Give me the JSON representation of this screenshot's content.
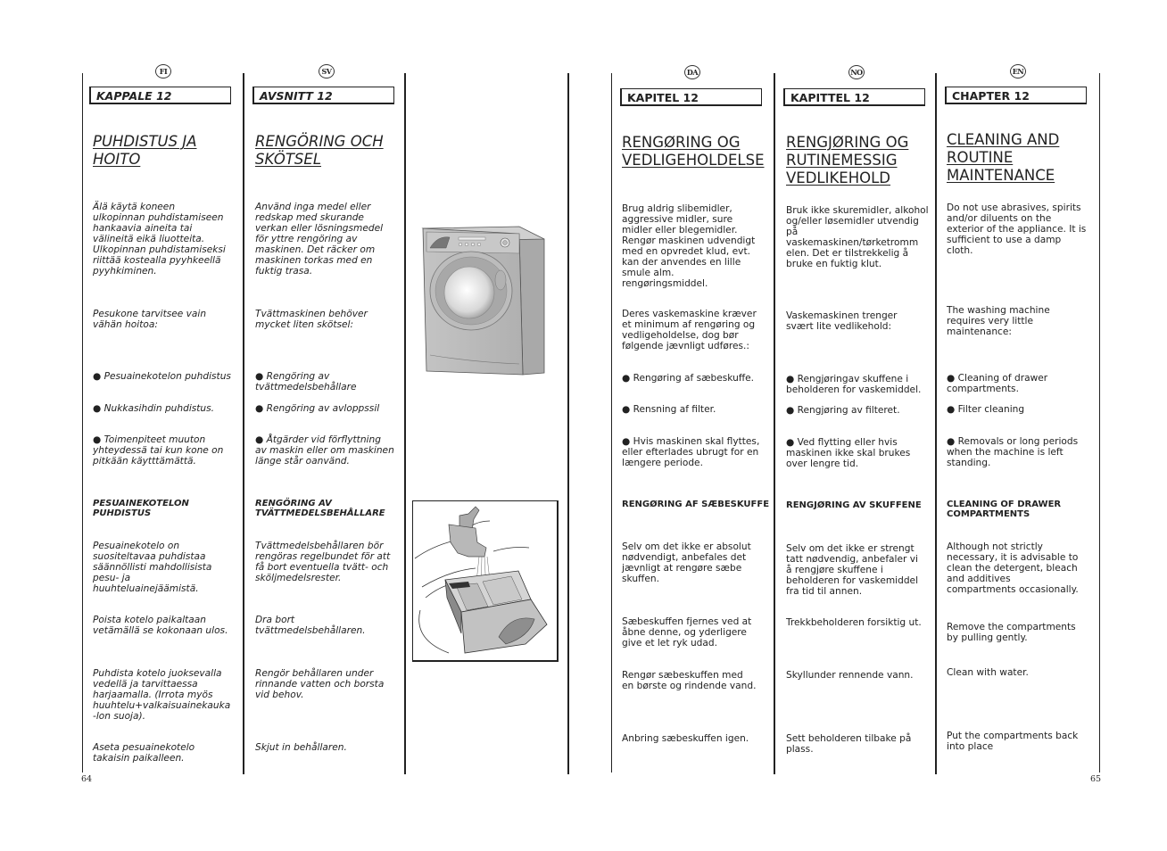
{
  "pages": [
    {
      "number": "64"
    },
    {
      "number": "65"
    }
  ],
  "columns": {
    "fi": {
      "lang_badge": "FI",
      "chapter": "KAPPALE 12",
      "title": "PUHDISTUS JA\nHOITO",
      "intro": "Älä käytä koneen\nulkopinnan puhdistamiseen\nhankaavia aineita tai\nvälineitä eikä liuotteita.\nUlkopinnan puhdistamiseksi\nriittää kostealla pyyhkeellä\npyyhkiminen.",
      "maintenance_intro": "Pesukone tarvitsee vain\nvähän hoitoa:",
      "bullets": [
        "● Pesuainekotelon puhdistus",
        "● Nukkasihdin puhdistus.",
        "● Toimenpiteet muuton\nyhteydessä tai kun kone on\npitkään käytttämättä."
      ],
      "subheading": "PESUAINEKOTELON\nPUHDISTUS",
      "steps": [
        "Pesuainekotelo on\nsuositeltavaa puhdistaa\nsäännöllisti mahdollisista\npesu- ja\nhuuhteluainejäämistä.",
        "Poista kotelo paikaltaan\nvetämällä se kokonaan ulos.",
        "Puhdista kotelo juoksevalla\nvedellä ja tarvittaessa\nharjaamalla. (Irrota myös\nhuuhtelu+valkaisuainekauka\n-lon suoja).",
        "Aseta pesuainekotelo\ntakaisin paikalleen."
      ]
    },
    "sv": {
      "lang_badge": "SV",
      "chapter": "AVSNITT 12",
      "title": "RENGÖRING OCH\nSKÖTSEL",
      "intro": "Använd inga medel eller\nredskap med skurande\nverkan eller lösningsmedel\nför yttre rengöring av\nmaskinen. Det räcker om\nmaskinen torkas med en\nfuktig trasa.",
      "maintenance_intro": "Tvättmaskinen behöver\nmycket liten skötsel:",
      "bullets": [
        "● Rengöring av\ntvättmedelsbehållare",
        "● Rengöring av avloppssil",
        "● Åtgärder vid förflyttning\nav maskin eller om maskinen\nlänge står oanvänd."
      ],
      "subheading": "RENGÖRING AV\nTVÄTTMEDELSBEHÅLLARE",
      "steps": [
        "Tvättmedelsbehållaren bör\nrengöras regelbundet för att\nfå bort eventuella tvätt- och\nsköljmedelsrester.",
        "Dra bort\ntvättmedelsbehållaren.",
        "Rengör behållaren under\nrinnande vatten och borsta\nvid behov.",
        "Skjut in behållaren."
      ]
    },
    "da": {
      "lang_badge": "DA",
      "chapter": "KAPITEL 12",
      "title": "RENGØRING OG\nVEDLIGEHOLDELSE",
      "intro": "Brug aldrig slibemidler,\naggressive midler, sure\nmidler eller blegemidler.\nRengør maskinen udvendigt\nmed en opvredet klud, evt.\nkan der anvendes en lille\nsmule alm.\nrengøringsmiddel.",
      "maintenance_intro": "Deres vaskemaskine kræver\net minimum af rengøring og\nvedligeholdelse, dog bør\nfølgende jævnligt udføres.:",
      "bullets": [
        "● Rengøring af sæbeskuffe.",
        "● Rensning af filter.",
        "● Hvis maskinen skal flyttes,\neller efterlades ubrugt for en\nlængere periode."
      ],
      "subheading": "RENGØRING AF SÆBESKUFFE",
      "steps": [
        "Selv om det ikke er absolut\nnødvendigt, anbefales det\njævnligt at rengøre sæbe\nskuffen.",
        "Sæbeskuffen fjernes ved at\nåbne denne, og yderligere\ngive et let ryk udad.",
        "Rengør sæbeskuffen med\nen børste og rindende vand.",
        "Anbring sæbeskuffen igen."
      ]
    },
    "no": {
      "lang_badge": "NO",
      "chapter": "KAPITTEL 12",
      "title": "RENGJØRING OG\nRUTINEMESSIG\nVEDLIKEHOLD",
      "intro": "Bruk ikke skuremidler, alkohol\nog/eller løsemidler utvendig\npå\nvaskemaskinen/tørketromm\nelen. Det er tilstrekkelig å\nbruke en fuktig klut.",
      "maintenance_intro": "Vaskemaskinen trenger\nsvært lite vedlikehold:",
      "bullets": [
        "● Rengjøringav skuffene i\nbeholderen for vaskemiddel.",
        "● Rengjøring av filteret.",
        "● Ved flytting eller hvis\nmaskinen ikke skal brukes\nover lengre tid."
      ],
      "subheading": "RENGJØRING AV SKUFFENE",
      "steps": [
        "Selv om det ikke er strengt\ntatt nødvendig, anbefaler vi\nå rengjøre skuffene i\nbeholderen for vaskemiddel\nfra tid til annen.",
        "Trekkbeholderen forsiktig ut.",
        "Skyllunder rennende vann.",
        "Sett beholderen tilbake på\nplass."
      ]
    },
    "en": {
      "lang_badge": "EN",
      "chapter": "CHAPTER 12",
      "title": "CLEANING AND\nROUTINE\nMAINTENANCE",
      "intro": "Do not use abrasives, spirits\nand/or diluents on the\nexterior of the appliance. It is\nsufficient to use a damp\ncloth.",
      "maintenance_intro": "The washing machine\nrequires very little\nmaintenance:",
      "bullets": [
        "● Cleaning of drawer\ncompartments.",
        "● Filter cleaning",
        "● Removals or long periods\nwhen the machine is left\nstanding."
      ],
      "subheading": "CLEANING OF DRAWER\nCOMPARTMENTS",
      "steps": [
        "Although not strictly\nnecessary, it is advisable to\nclean the detergent, bleach\nand additives\ncompartments occasionally.",
        "Remove the compartments\nby pulling gently.",
        "Clean with water.",
        "Put the compartments back\ninto place"
      ]
    }
  },
  "illustrations": {
    "washing_machine": "washing-machine-illustration",
    "drawer_cleaning": "detergent-drawer-under-tap-illustration"
  },
  "colors": {
    "ink": "#222222",
    "rule": "#222222",
    "machine_gray": "#bdbdbd"
  }
}
